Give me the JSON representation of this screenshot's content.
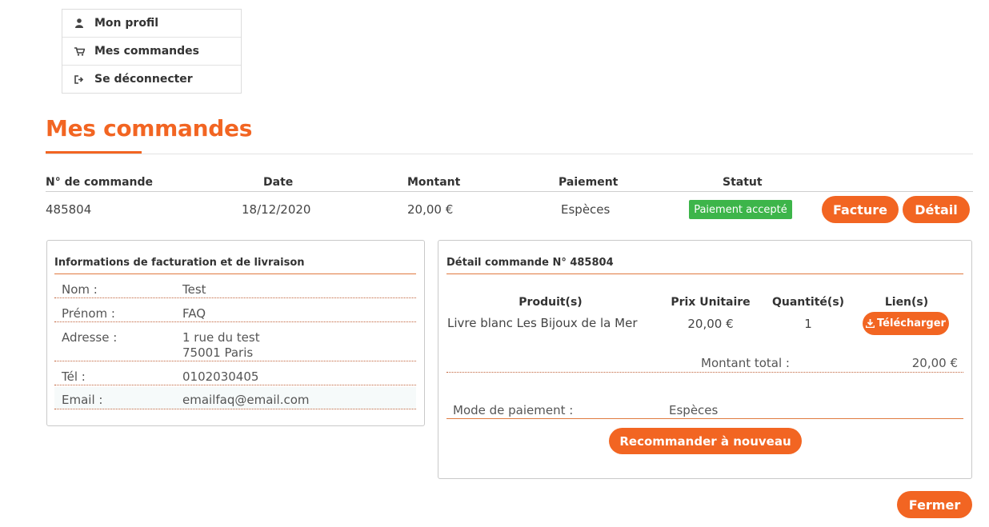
{
  "menu": {
    "items": [
      {
        "label": "Mon profil",
        "icon": "user-icon"
      },
      {
        "label": "Mes commandes",
        "icon": "cart-icon"
      },
      {
        "label": "Se déconnecter",
        "icon": "logout-icon"
      }
    ]
  },
  "page_title": "Mes commandes",
  "orders_table": {
    "headers": {
      "number": "N° de commande",
      "date": "Date",
      "amount": "Montant",
      "payment": "Paiement",
      "status": "Statut"
    },
    "row": {
      "number": "485804",
      "date": "18/12/2020",
      "amount": "20,00 €",
      "payment": "Espèces",
      "status": "Paiement accepté",
      "invoice_label": "Facture",
      "detail_label": "Détail"
    }
  },
  "billing": {
    "title": "Informations de facturation et de livraison",
    "rows": [
      {
        "label": "Nom :",
        "value": "Test"
      },
      {
        "label": "Prénom :",
        "value": "FAQ"
      },
      {
        "label": "Adresse :",
        "value": "1 rue du test",
        "value2": "75001 Paris"
      },
      {
        "label": "Tél :",
        "value": "0102030405"
      },
      {
        "label": "Email :",
        "value": "emailfaq@email.com"
      }
    ]
  },
  "detail": {
    "title": "Détail commande N° 485804",
    "headers": {
      "product": "Produit(s)",
      "unit_price": "Prix Unitaire",
      "quantity": "Quantité(s)",
      "links": "Lien(s)"
    },
    "item": {
      "product": "Livre blanc Les Bijoux de la Mer",
      "unit_price": "20,00 €",
      "quantity": "1",
      "download_label": "Télécharger"
    },
    "total_label": "Montant total :",
    "total_value": "20,00 €",
    "payment_label": "Mode de paiement :",
    "payment_value": "Espèces",
    "reorder_label": "Recommander à nouveau"
  },
  "close_label": "Fermer",
  "colors": {
    "accent": "#f26522",
    "status_green": "#3db54a"
  }
}
